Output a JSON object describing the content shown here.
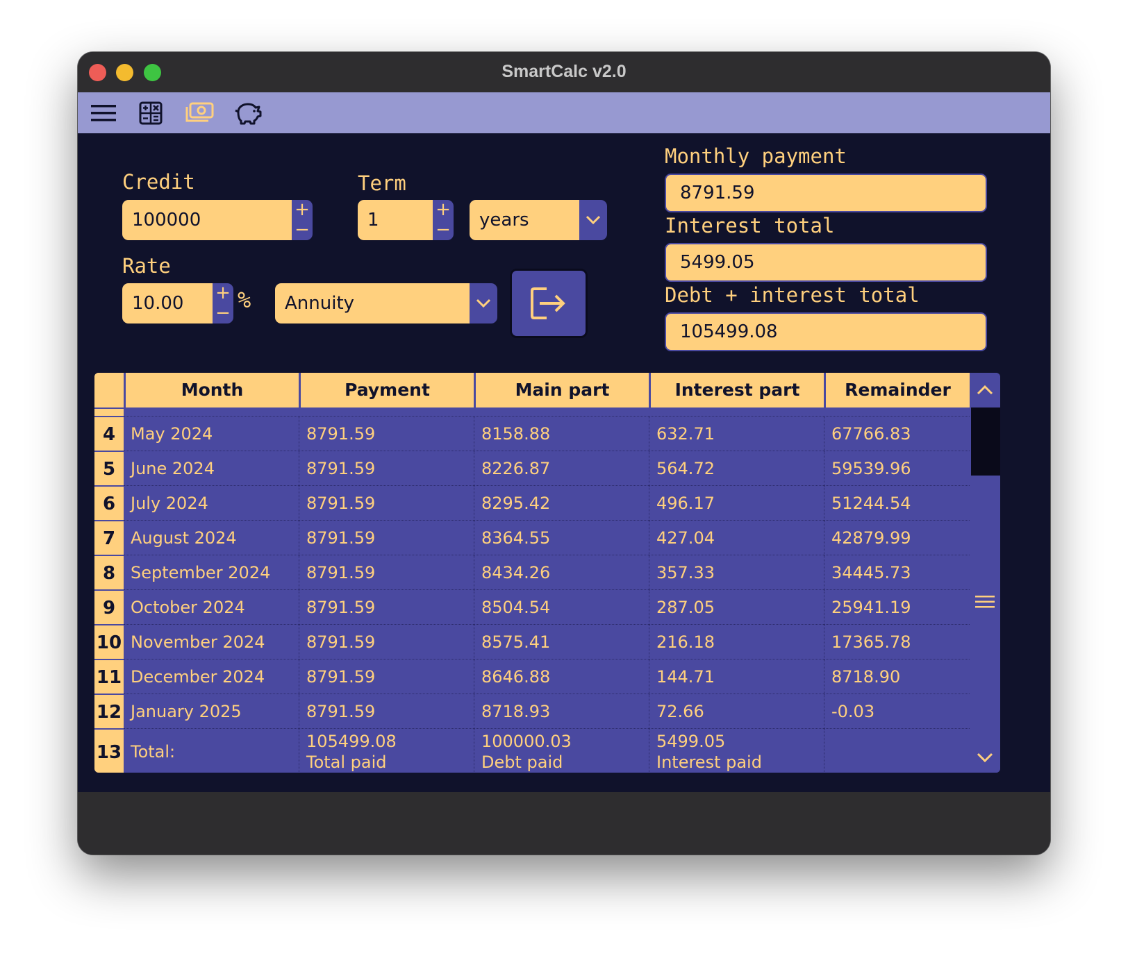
{
  "window": {
    "title": "SmartCalc v2.0"
  },
  "toolbar": {
    "icons": [
      "menu-icon",
      "calculator-icon",
      "money-icon",
      "piggy-bank-icon"
    ]
  },
  "form": {
    "credit_label": "Credit",
    "credit_value": "100000",
    "term_label": "Term",
    "term_value": "1",
    "term_unit": "years",
    "rate_label": "Rate",
    "rate_value": "10.00",
    "percent_sign": "%",
    "type_value": "Annuity",
    "spin_plus": "+",
    "spin_minus": "−"
  },
  "results": {
    "monthly_label": "Monthly payment",
    "monthly_value": "8791.59",
    "interest_label": "Interest total",
    "interest_value": "5499.05",
    "total_label": "Debt + interest total",
    "total_value": "105499.08"
  },
  "table": {
    "headers": [
      "Month",
      "Payment",
      "Main part",
      "Interest part",
      "Remainder"
    ],
    "rows": [
      {
        "num": "4",
        "cells": [
          "May 2024",
          "8791.59",
          "8158.88",
          "632.71",
          "67766.83"
        ]
      },
      {
        "num": "5",
        "cells": [
          "June 2024",
          "8791.59",
          "8226.87",
          "564.72",
          "59539.96"
        ]
      },
      {
        "num": "6",
        "cells": [
          "July 2024",
          "8791.59",
          "8295.42",
          "496.17",
          "51244.54"
        ]
      },
      {
        "num": "7",
        "cells": [
          "August 2024",
          "8791.59",
          "8364.55",
          "427.04",
          "42879.99"
        ]
      },
      {
        "num": "8",
        "cells": [
          "September 2024",
          "8791.59",
          "8434.26",
          "357.33",
          "34445.73"
        ]
      },
      {
        "num": "9",
        "cells": [
          "October 2024",
          "8791.59",
          "8504.54",
          "287.05",
          "25941.19"
        ]
      },
      {
        "num": "10",
        "cells": [
          "November 2024",
          "8791.59",
          "8575.41",
          "216.18",
          "17365.78"
        ]
      },
      {
        "num": "11",
        "cells": [
          "December 2024",
          "8791.59",
          "8646.88",
          "144.71",
          "8718.90"
        ]
      },
      {
        "num": "12",
        "cells": [
          "January 2025",
          "8791.59",
          "8718.93",
          "72.66",
          "-0.03"
        ]
      }
    ],
    "total_row": {
      "num": "13",
      "label": "Total:",
      "payment": "105499.08",
      "payment_caption": "Total paid",
      "main": "100000.03",
      "main_caption": "Debt paid",
      "interest": "5499.05",
      "interest_caption": "Interest paid",
      "remainder": ""
    }
  }
}
